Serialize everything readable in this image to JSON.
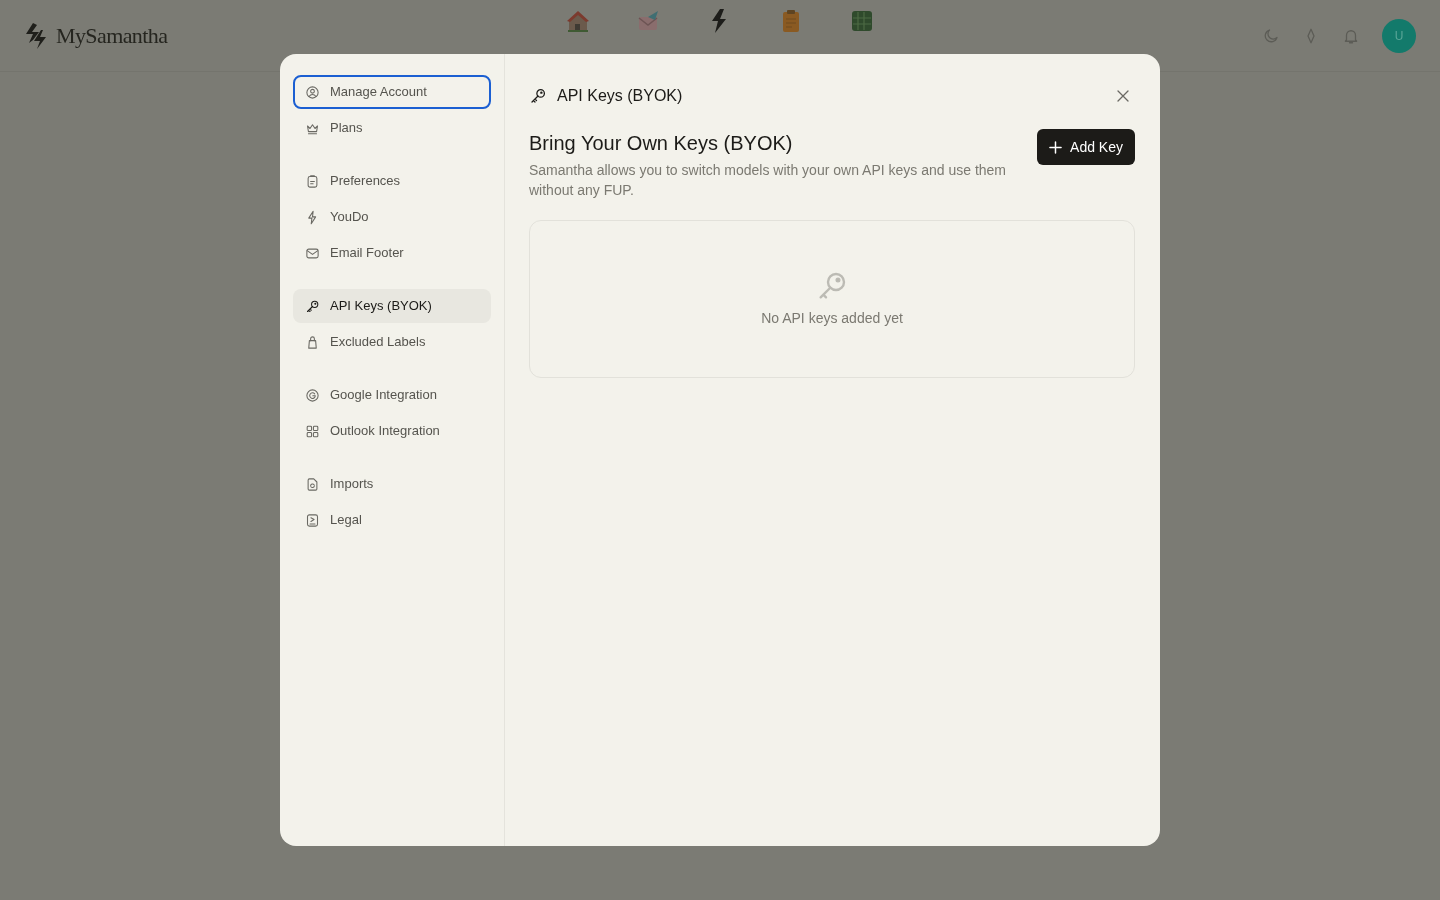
{
  "topbar": {
    "logo_text": "MySamantha",
    "avatar_text": "U"
  },
  "settings": {
    "sidebar": {
      "groups": [
        {
          "items": [
            {
              "label": "Manage Account",
              "selected": false,
              "focused": true
            },
            {
              "label": "Plans",
              "selected": false,
              "focused": false
            }
          ]
        },
        {
          "items": [
            {
              "label": "Preferences",
              "selected": false,
              "focused": false
            },
            {
              "label": "YouDo",
              "selected": false,
              "focused": false
            },
            {
              "label": "Email Footer",
              "selected": false,
              "focused": false
            }
          ]
        },
        {
          "items": [
            {
              "label": "API Keys (BYOK)",
              "selected": true,
              "focused": false
            },
            {
              "label": "Excluded Labels",
              "selected": false,
              "focused": false
            }
          ]
        },
        {
          "items": [
            {
              "label": "Google Integration",
              "selected": false,
              "focused": false
            },
            {
              "label": "Outlook Integration",
              "selected": false,
              "focused": false
            }
          ]
        },
        {
          "items": [
            {
              "label": "Imports",
              "selected": false,
              "focused": false
            },
            {
              "label": "Legal",
              "selected": false,
              "focused": false
            }
          ]
        }
      ]
    },
    "header": {
      "title": "API Keys (BYOK)"
    },
    "section": {
      "heading": "Bring Your Own Keys (BYOK)",
      "description": "Samantha allows you to switch models with your own API keys and use them without any FUP.",
      "add_button": "Add Key"
    },
    "empty_state": {
      "text": "No API keys added yet"
    }
  }
}
